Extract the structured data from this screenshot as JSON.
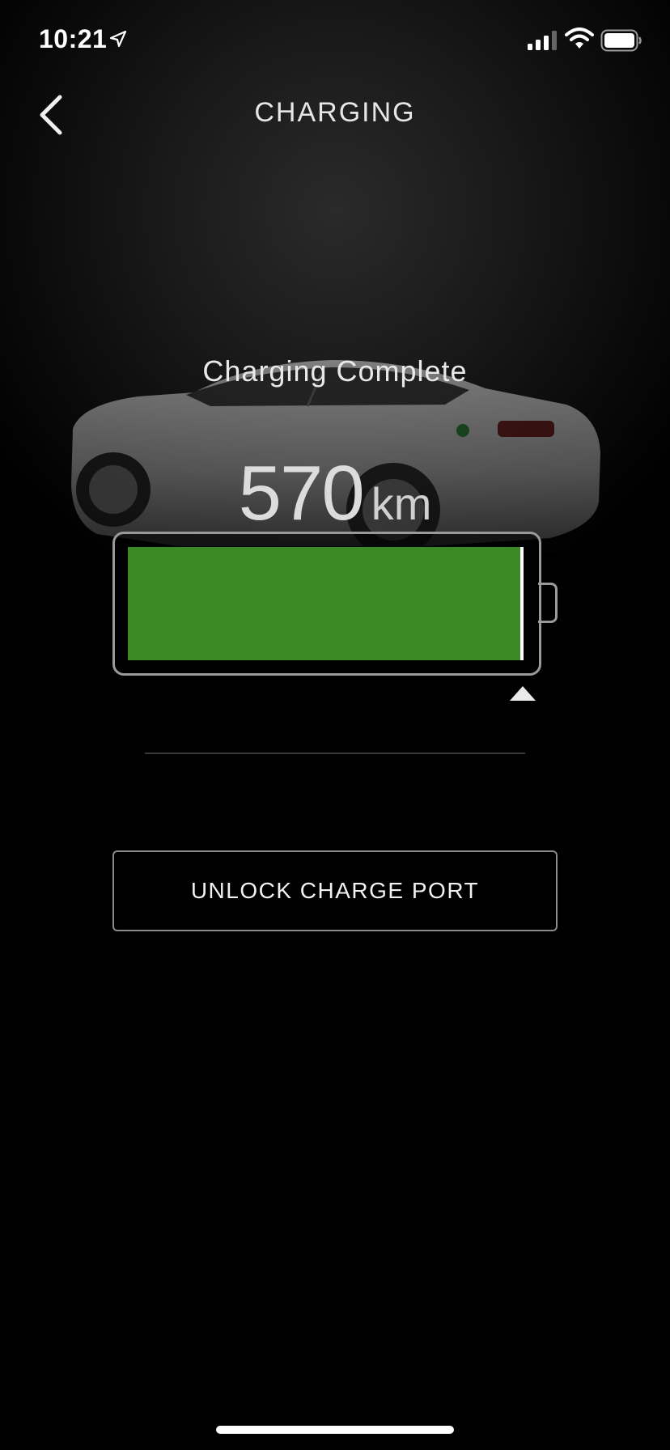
{
  "status_bar": {
    "time": "10:21",
    "icons": [
      "location-arrow-icon",
      "cellular-signal-icon",
      "wifi-icon",
      "battery-icon"
    ]
  },
  "nav": {
    "back_icon": "chevron-left-icon",
    "title": "CHARGING"
  },
  "charging": {
    "status": "Charging Complete",
    "range_value": "570",
    "range_unit": "km",
    "charge_level": 0.99,
    "charge_limit": 0.99,
    "fill_color": "#3c8a26"
  },
  "actions": {
    "unlock_label": "UNLOCK CHARGE PORT"
  },
  "colors": {
    "background": "#000000",
    "battery_outline": "#9a9a9a",
    "charge_green": "#3c8a26"
  }
}
